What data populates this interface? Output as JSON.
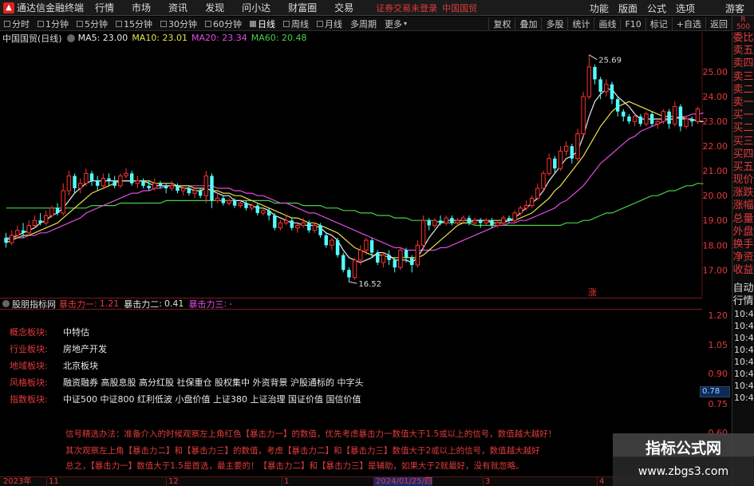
{
  "menubar": {
    "app_title": "通达信金融终端",
    "items": [
      "行情",
      "市场",
      "资讯",
      "发现",
      "问小达",
      "财富圈",
      "交易"
    ],
    "notice": "证券交易未登录",
    "notice_stock": "中国国贸",
    "right_items": [
      "功能",
      "版面",
      "公式",
      "选项"
    ],
    "right_user": "游客"
  },
  "periodbar": {
    "periods": [
      "分时",
      "1分钟",
      "5分钟",
      "15分钟",
      "30分钟",
      "60分钟",
      "日线",
      "周线",
      "月线",
      "多周期",
      "更多"
    ],
    "selected": "日线",
    "tools": [
      "复权",
      "叠加",
      "多股",
      "统计",
      "画线",
      "F10",
      "标记",
      "+自选",
      "返回"
    ],
    "r_box_top": "R",
    "r_box_bottom": "500"
  },
  "ma_legend": {
    "title": "中国国贸(日线)",
    "ma5": "MA5: 23.00",
    "ma10": "MA10: 23.01",
    "ma20": "MA20: 23.34",
    "ma60": "MA60: 20.48"
  },
  "price_axis": {
    "ticks": [
      "25.00",
      "24.00",
      "23.00",
      "22.00",
      "21.00",
      "20.00",
      "19.00",
      "18.00",
      "17.00"
    ],
    "high_label": "25.69",
    "low_label": "16.52",
    "zhang_marker": "涨"
  },
  "indicator": {
    "name": "股朋指标网",
    "line1_label": "暴击力一",
    "line1_value": "1.21",
    "line2_label": "暴击力二",
    "line2_value": "0.41",
    "line3_label": "暴击力三",
    "line3_value": "-",
    "axis_ticks": [
      "1.20",
      "1.05",
      "0.90",
      "0.75",
      "0.60"
    ],
    "cursor_value": "0.78"
  },
  "info_rows": [
    {
      "key": "概念板块:",
      "val": "中特估"
    },
    {
      "key": "行业板块:",
      "val": "房地产开发"
    },
    {
      "key": "地域板块:",
      "val": "北京板块"
    },
    {
      "key": "风格板块:",
      "val": "融资融券 高股息股 高分红股 社保重仓 股权集中 外资背景 沪股通标的 中字头"
    },
    {
      "key": "指数板块:",
      "val": "中证500 中证800 红利低波 小盘价值 上证380 上证治理 国证价值 国信价值"
    }
  ],
  "notes": [
    "信号精选办法：准备介入的时候观察左上角红色【暴击力一】的数值，优先考虑暴击力一数值大于1.5或以上的信号，数值越大越好！",
    "其次观察左上角【暴击力二】和【暴击力三】的数值，考虑【暴击力二】和【暴击力三】数值大于2或以上的信号，数值越大越好",
    "总之，【暴击力一】数值大于1.5是首选，最主要的！【暴击力二】和【暴击力三】是辅助，如果大于2就最好，没有就忽略。"
  ],
  "side_panel": {
    "items": [
      "委比",
      "卖五",
      "卖四",
      "卖三",
      "卖二",
      "卖一",
      "买一",
      "买二",
      "买三",
      "买四",
      "买五",
      "现价",
      "涨跌",
      "涨幅",
      "总量",
      "外盘",
      "换手",
      "净资",
      "收益"
    ],
    "lower_items": [
      "自动",
      "行情"
    ],
    "times": [
      "10:4",
      "10:4",
      "10:4",
      "10:4",
      "10:4",
      "10:4",
      "10:4",
      "10:4"
    ]
  },
  "time_axis": {
    "labels": [
      "2023年",
      "11",
      "12",
      "1",
      "2024/01/25/四",
      "3",
      "4"
    ]
  },
  "watermark": {
    "brand": "指标公式网",
    "url": "www.zbgs3.com"
  },
  "colors": {
    "up": "#ff3232",
    "down": "#54fcfc",
    "ma5": "#e9e9e9",
    "ma10": "#e8e24a",
    "ma20": "#e04ce0",
    "ma60": "#49d049",
    "axis_red": "#e23b3b",
    "grid": "#5a1515"
  },
  "chart_data": {
    "type": "candlestick",
    "ylim": [
      16.3,
      26.1
    ],
    "candles": [
      [
        18.3,
        18.1,
        18.5,
        17.9
      ],
      [
        18.1,
        18.4,
        18.6,
        18.0
      ],
      [
        18.4,
        18.6,
        18.8,
        18.3
      ],
      [
        18.6,
        18.5,
        18.9,
        18.3
      ],
      [
        18.5,
        18.8,
        19.0,
        18.4
      ],
      [
        18.8,
        19.0,
        19.2,
        18.7
      ],
      [
        19.0,
        18.9,
        19.3,
        18.8
      ],
      [
        18.9,
        19.2,
        19.4,
        18.8
      ],
      [
        19.2,
        19.5,
        19.6,
        19.1
      ],
      [
        19.5,
        19.3,
        19.7,
        19.2
      ],
      [
        19.3,
        20.2,
        20.5,
        19.2
      ],
      [
        20.2,
        20.8,
        21.0,
        20.0
      ],
      [
        20.8,
        20.3,
        20.9,
        20.1
      ],
      [
        20.3,
        20.5,
        20.7,
        20.1
      ],
      [
        20.5,
        20.9,
        21.1,
        20.4
      ],
      [
        20.9,
        20.6,
        21.0,
        20.4
      ],
      [
        20.6,
        20.4,
        20.8,
        20.2
      ],
      [
        20.4,
        20.7,
        20.9,
        20.3
      ],
      [
        20.7,
        20.6,
        20.9,
        20.4
      ],
      [
        20.6,
        20.4,
        20.8,
        20.3
      ],
      [
        20.4,
        20.8,
        20.9,
        20.3
      ],
      [
        20.8,
        20.9,
        21.1,
        20.7
      ],
      [
        20.9,
        20.5,
        21.0,
        20.4
      ],
      [
        20.5,
        20.6,
        20.8,
        20.3
      ],
      [
        20.6,
        20.4,
        20.7,
        20.3
      ],
      [
        20.4,
        20.3,
        20.6,
        20.2
      ],
      [
        20.3,
        20.5,
        20.7,
        20.2
      ],
      [
        20.5,
        20.4,
        20.6,
        20.3
      ],
      [
        20.4,
        20.3,
        20.5,
        20.1
      ],
      [
        20.3,
        20.4,
        20.6,
        20.2
      ],
      [
        20.4,
        20.2,
        20.5,
        20.1
      ],
      [
        20.2,
        20.3,
        20.4,
        20.0
      ],
      [
        20.3,
        20.1,
        20.4,
        20.0
      ],
      [
        20.1,
        20.2,
        20.3,
        19.9
      ],
      [
        20.2,
        20.0,
        20.3,
        19.9
      ],
      [
        20.0,
        20.8,
        21.0,
        19.7
      ],
      [
        20.8,
        19.8,
        20.9,
        19.5
      ],
      [
        19.8,
        19.9,
        20.1,
        19.7
      ],
      [
        19.9,
        19.7,
        20.0,
        19.6
      ],
      [
        19.7,
        19.8,
        19.9,
        19.6
      ],
      [
        19.8,
        19.6,
        19.9,
        19.5
      ],
      [
        19.6,
        19.7,
        19.8,
        19.5
      ],
      [
        19.7,
        19.5,
        19.8,
        19.4
      ],
      [
        19.5,
        19.6,
        19.7,
        19.4
      ],
      [
        19.6,
        19.3,
        19.7,
        19.2
      ],
      [
        19.3,
        19.4,
        19.5,
        19.2
      ],
      [
        19.4,
        19.2,
        19.5,
        19.0
      ],
      [
        19.2,
        18.7,
        19.3,
        18.6
      ],
      [
        18.7,
        18.9,
        19.0,
        18.6
      ],
      [
        18.9,
        19.0,
        19.2,
        18.8
      ],
      [
        19.0,
        18.7,
        19.1,
        18.6
      ],
      [
        18.7,
        18.8,
        18.9,
        18.5
      ],
      [
        18.8,
        18.9,
        19.1,
        18.7
      ],
      [
        18.9,
        18.6,
        19.0,
        18.5
      ],
      [
        18.6,
        18.8,
        18.9,
        18.5
      ],
      [
        18.8,
        18.4,
        18.9,
        18.3
      ],
      [
        18.4,
        18.0,
        18.5,
        17.9
      ],
      [
        18.0,
        18.2,
        18.3,
        17.8
      ],
      [
        18.2,
        17.6,
        18.3,
        17.5
      ],
      [
        17.6,
        17.0,
        17.7,
        16.9
      ],
      [
        17.0,
        16.7,
        17.1,
        16.52
      ],
      [
        16.7,
        17.4,
        17.5,
        16.6
      ],
      [
        17.4,
        17.8,
        18.0,
        17.2
      ],
      [
        17.8,
        18.2,
        18.3,
        17.6
      ],
      [
        18.2,
        17.7,
        18.3,
        17.5
      ],
      [
        17.7,
        17.3,
        17.8,
        17.2
      ],
      [
        17.3,
        17.6,
        17.7,
        17.1
      ],
      [
        17.6,
        17.4,
        17.8,
        17.2
      ],
      [
        17.4,
        17.1,
        17.5,
        16.9
      ],
      [
        17.1,
        17.8,
        17.9,
        17.0
      ],
      [
        17.8,
        17.5,
        17.9,
        17.3
      ],
      [
        17.5,
        17.2,
        17.6,
        16.9
      ],
      [
        17.2,
        18.0,
        18.2,
        17.1
      ],
      [
        18.0,
        19.0,
        19.2,
        17.9
      ],
      [
        19.0,
        18.8,
        19.1,
        18.6
      ],
      [
        18.8,
        19.0,
        19.1,
        18.7
      ],
      [
        19.0,
        18.9,
        19.2,
        18.8
      ],
      [
        18.9,
        19.1,
        19.2,
        18.8
      ],
      [
        19.1,
        18.9,
        19.2,
        18.8
      ],
      [
        18.9,
        19.0,
        19.1,
        18.8
      ],
      [
        19.0,
        19.1,
        19.2,
        18.9
      ],
      [
        19.1,
        18.9,
        19.2,
        18.8
      ],
      [
        18.9,
        19.0,
        19.1,
        18.8
      ],
      [
        19.0,
        18.9,
        19.1,
        18.7
      ],
      [
        18.9,
        19.0,
        19.1,
        18.8
      ],
      [
        19.0,
        18.8,
        19.1,
        18.7
      ],
      [
        18.8,
        18.9,
        19.0,
        18.7
      ],
      [
        18.9,
        19.1,
        19.2,
        18.8
      ],
      [
        19.1,
        19.0,
        19.2,
        18.9
      ],
      [
        19.0,
        19.3,
        19.4,
        18.9
      ],
      [
        19.3,
        19.5,
        19.6,
        19.2
      ],
      [
        19.5,
        19.6,
        19.8,
        19.4
      ],
      [
        19.6,
        19.9,
        20.0,
        19.5
      ],
      [
        19.9,
        20.3,
        20.5,
        19.8
      ],
      [
        20.3,
        20.9,
        21.0,
        20.2
      ],
      [
        20.9,
        21.5,
        21.7,
        20.8
      ],
      [
        21.5,
        21.1,
        21.6,
        20.9
      ],
      [
        21.1,
        21.8,
        22.0,
        21.0
      ],
      [
        21.8,
        22.0,
        22.2,
        21.6
      ],
      [
        22.0,
        21.5,
        22.1,
        21.3
      ],
      [
        21.5,
        22.5,
        22.7,
        21.4
      ],
      [
        22.5,
        24.0,
        24.2,
        22.4
      ],
      [
        24.0,
        25.2,
        25.69,
        23.9
      ],
      [
        25.2,
        24.7,
        25.3,
        24.5
      ],
      [
        24.7,
        24.2,
        24.8,
        23.9
      ],
      [
        24.2,
        24.5,
        24.7,
        24.0
      ],
      [
        24.5,
        23.9,
        24.6,
        23.7
      ],
      [
        23.9,
        23.4,
        24.0,
        23.2
      ],
      [
        23.4,
        23.2,
        23.5,
        23.0
      ],
      [
        23.2,
        23.0,
        23.3,
        22.9
      ],
      [
        23.0,
        23.2,
        23.3,
        22.8
      ],
      [
        23.2,
        22.9,
        23.3,
        22.8
      ],
      [
        22.9,
        23.3,
        23.4,
        22.8
      ],
      [
        23.3,
        22.9,
        23.4,
        22.8
      ],
      [
        22.9,
        23.0,
        23.1,
        22.7
      ],
      [
        23.0,
        23.4,
        23.5,
        22.9
      ],
      [
        23.4,
        22.9,
        23.5,
        22.7
      ],
      [
        22.9,
        23.6,
        23.8,
        22.8
      ],
      [
        23.6,
        22.8,
        23.7,
        22.6
      ],
      [
        22.8,
        23.1,
        23.2,
        22.7
      ],
      [
        23.1,
        23.0,
        23.2,
        22.8
      ],
      [
        23.0,
        23.5,
        23.6,
        22.9
      ]
    ],
    "ma5": [
      18.2,
      18.3,
      18.4,
      18.5,
      18.6,
      18.7,
      18.9,
      19.0,
      19.2,
      19.3,
      19.5,
      19.8,
      20.1,
      20.3,
      20.5,
      20.6,
      20.6,
      20.6,
      20.6,
      20.6,
      20.6,
      20.6,
      20.6,
      20.6,
      20.6,
      20.5,
      20.4,
      20.4,
      20.4,
      20.4,
      20.4,
      20.3,
      20.3,
      20.2,
      20.2,
      20.3,
      20.2,
      20.1,
      20.0,
      20.0,
      19.8,
      19.8,
      19.7,
      19.6,
      19.5,
      19.5,
      19.4,
      19.2,
      19.1,
      19.0,
      18.9,
      18.9,
      18.8,
      18.8,
      18.8,
      18.7,
      18.5,
      18.4,
      18.2,
      17.8,
      17.5,
      17.4,
      17.3,
      17.4,
      17.5,
      17.7,
      17.7,
      17.6,
      17.4,
      17.4,
      17.4,
      17.3,
      17.5,
      17.9,
      18.3,
      18.6,
      18.9,
      19.0,
      19.0,
      19.0,
      19.0,
      19.0,
      19.0,
      19.0,
      19.0,
      18.9,
      18.9,
      18.9,
      19.0,
      19.1,
      19.3,
      19.5,
      19.7,
      19.9,
      20.2,
      20.6,
      20.9,
      21.2,
      21.5,
      21.6,
      21.8,
      22.4,
      23.2,
      23.8,
      24.1,
      24.3,
      24.3,
      24.0,
      23.8,
      23.6,
      23.3,
      23.1,
      23.1,
      23.1,
      23.1,
      23.1,
      23.1,
      23.1,
      23.2,
      23.1,
      23.1,
      23.0,
      23.0
    ],
    "ma10": [
      18.1,
      18.2,
      18.3,
      18.4,
      18.4,
      18.5,
      18.6,
      18.7,
      18.8,
      18.9,
      19.1,
      19.3,
      19.5,
      19.7,
      19.9,
      20.1,
      20.2,
      20.3,
      20.4,
      20.5,
      20.6,
      20.6,
      20.6,
      20.6,
      20.6,
      20.6,
      20.5,
      20.5,
      20.5,
      20.5,
      20.4,
      20.4,
      20.4,
      20.3,
      20.3,
      20.3,
      20.2,
      20.2,
      20.1,
      20.1,
      20.0,
      20.0,
      19.9,
      19.8,
      19.7,
      19.6,
      19.5,
      19.4,
      19.3,
      19.2,
      19.1,
      19.1,
      19.0,
      18.9,
      18.9,
      18.8,
      18.7,
      18.6,
      18.5,
      18.3,
      18.1,
      17.9,
      17.8,
      17.7,
      17.6,
      17.6,
      17.6,
      17.5,
      17.5,
      17.5,
      17.5,
      17.5,
      17.5,
      17.6,
      17.8,
      18.0,
      18.2,
      18.4,
      18.6,
      18.8,
      18.9,
      18.9,
      19.0,
      19.0,
      19.0,
      19.0,
      19.0,
      19.0,
      19.0,
      19.0,
      19.1,
      19.2,
      19.3,
      19.5,
      19.7,
      19.9,
      20.2,
      20.4,
      20.7,
      21.0,
      21.3,
      21.6,
      22.0,
      22.4,
      22.8,
      23.1,
      23.4,
      23.6,
      23.7,
      23.8,
      23.7,
      23.6,
      23.5,
      23.4,
      23.3,
      23.2,
      23.2,
      23.2,
      23.1,
      23.1,
      23.1,
      23.0,
      23.0
    ],
    "ma20": [
      18.3,
      18.3,
      18.3,
      18.3,
      18.4,
      18.4,
      18.5,
      18.5,
      18.6,
      18.7,
      18.8,
      18.9,
      19.0,
      19.1,
      19.3,
      19.4,
      19.5,
      19.6,
      19.7,
      19.8,
      19.9,
      20.0,
      20.1,
      20.1,
      20.2,
      20.2,
      20.3,
      20.3,
      20.4,
      20.4,
      20.4,
      20.4,
      20.4,
      20.4,
      20.4,
      20.4,
      20.4,
      20.3,
      20.3,
      20.3,
      20.2,
      20.2,
      20.1,
      20.1,
      20.0,
      20.0,
      19.9,
      19.8,
      19.7,
      19.7,
      19.6,
      19.5,
      19.4,
      19.3,
      19.3,
      19.2,
      19.1,
      19.0,
      18.9,
      18.8,
      18.7,
      18.6,
      18.5,
      18.4,
      18.3,
      18.2,
      18.1,
      18.0,
      17.9,
      17.9,
      17.8,
      17.8,
      17.8,
      17.8,
      17.8,
      17.8,
      17.9,
      17.9,
      18.0,
      18.1,
      18.2,
      18.3,
      18.4,
      18.5,
      18.6,
      18.7,
      18.8,
      18.8,
      18.9,
      18.9,
      19.0,
      19.0,
      19.1,
      19.2,
      19.3,
      19.4,
      19.5,
      19.7,
      19.8,
      20.0,
      20.2,
      20.4,
      20.7,
      21.0,
      21.3,
      21.5,
      21.7,
      21.9,
      22.1,
      22.3,
      22.4,
      22.6,
      22.7,
      22.8,
      22.9,
      23.0,
      23.1,
      23.1,
      23.2,
      23.2,
      23.3,
      23.3,
      23.34
    ],
    "ma60": [
      19.5,
      19.5,
      19.5,
      19.5,
      19.5,
      19.5,
      19.5,
      19.5,
      19.5,
      19.5,
      19.5,
      19.5,
      19.5,
      19.5,
      19.5,
      19.6,
      19.6,
      19.6,
      19.6,
      19.6,
      19.7,
      19.7,
      19.7,
      19.7,
      19.7,
      19.7,
      19.7,
      19.7,
      19.8,
      19.8,
      19.8,
      19.8,
      19.8,
      19.8,
      19.8,
      19.8,
      19.8,
      19.8,
      19.8,
      19.8,
      19.8,
      19.8,
      19.8,
      19.8,
      19.8,
      19.8,
      19.8,
      19.7,
      19.7,
      19.7,
      19.7,
      19.7,
      19.6,
      19.6,
      19.6,
      19.6,
      19.5,
      19.5,
      19.5,
      19.4,
      19.4,
      19.4,
      19.3,
      19.3,
      19.3,
      19.2,
      19.2,
      19.2,
      19.1,
      19.1,
      19.1,
      19.0,
      19.0,
      19.0,
      19.0,
      19.0,
      18.9,
      18.9,
      18.9,
      18.9,
      18.9,
      18.9,
      18.8,
      18.8,
      18.8,
      18.8,
      18.8,
      18.8,
      18.8,
      18.8,
      18.8,
      18.8,
      18.8,
      18.8,
      18.8,
      18.8,
      18.8,
      18.8,
      18.9,
      18.9,
      18.9,
      19.0,
      19.0,
      19.1,
      19.2,
      19.3,
      19.3,
      19.4,
      19.5,
      19.6,
      19.7,
      19.8,
      19.9,
      20.0,
      20.0,
      20.1,
      20.2,
      20.2,
      20.3,
      20.4,
      20.4,
      20.5,
      20.48
    ]
  }
}
